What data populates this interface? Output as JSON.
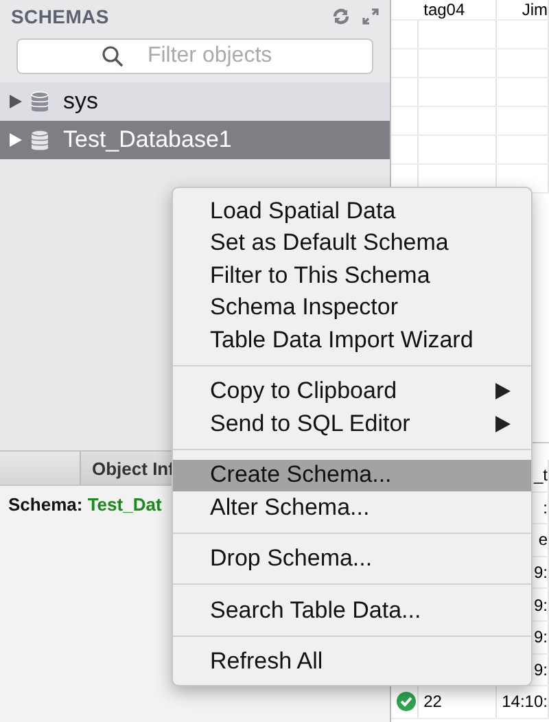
{
  "schemas_panel": {
    "title": "SCHEMAS",
    "search": {
      "placeholder": "Filter objects"
    },
    "items": [
      {
        "label": "sys",
        "selected": false,
        "expanded": false
      },
      {
        "label": "Test_Database1",
        "selected": true,
        "expanded": false
      }
    ]
  },
  "info_panel": {
    "tabs": [
      {
        "selected": false
      },
      {
        "label": "Object Inf",
        "selected": true
      }
    ],
    "schema_label": "Schema:",
    "schema_name": "Test_Dat"
  },
  "result_grid_top": {
    "rows": [
      [
        "",
        "tag04",
        "Jim"
      ],
      [
        "",
        "",
        ""
      ],
      [
        "",
        "",
        ""
      ],
      [
        "",
        "",
        ""
      ],
      [
        "",
        "",
        ""
      ],
      [
        "",
        "",
        ""
      ],
      [
        "",
        "",
        ""
      ]
    ]
  },
  "result_grid_bottom": {
    "rows": [
      {
        "cells": [
          "",
          "",
          "_t"
        ]
      },
      {
        "cells": [
          "",
          "",
          ":"
        ]
      },
      {
        "cells": [
          "",
          "",
          "e"
        ]
      },
      {
        "cells": [
          "",
          "",
          "9:"
        ]
      },
      {
        "cells": [
          "",
          "",
          "9:"
        ]
      },
      {
        "cells": [
          "",
          "",
          "9:"
        ]
      },
      {
        "cells": [
          "",
          "",
          "9:"
        ]
      },
      {
        "ok": true,
        "cells": [
          "",
          "22",
          "14:10:"
        ]
      }
    ]
  },
  "context_menu": {
    "items": [
      {
        "kind": "item",
        "label": "Load Spatial Data",
        "selected": false,
        "submenu": false
      },
      {
        "kind": "item",
        "label": "Set as Default Schema",
        "selected": false,
        "submenu": false
      },
      {
        "kind": "item",
        "label": "Filter to This Schema",
        "selected": false,
        "submenu": false
      },
      {
        "kind": "item",
        "label": "Schema Inspector",
        "selected": false,
        "submenu": false
      },
      {
        "kind": "item",
        "label": "Table Data Import Wizard",
        "selected": false,
        "submenu": false
      },
      {
        "kind": "separator"
      },
      {
        "kind": "item",
        "label": "Copy to Clipboard",
        "selected": false,
        "submenu": true
      },
      {
        "kind": "item",
        "label": "Send to SQL Editor",
        "selected": false,
        "submenu": true
      },
      {
        "kind": "separator"
      },
      {
        "kind": "item",
        "label": "Create Schema...",
        "selected": true,
        "submenu": false
      },
      {
        "kind": "item",
        "label": "Alter Schema...",
        "selected": false,
        "submenu": false
      },
      {
        "kind": "separator"
      },
      {
        "kind": "item",
        "label": "Drop Schema...",
        "selected": false,
        "submenu": false
      },
      {
        "kind": "separator"
      },
      {
        "kind": "item",
        "label": "Search Table Data...",
        "selected": false,
        "submenu": false
      },
      {
        "kind": "separator"
      },
      {
        "kind": "item",
        "label": "Refresh All",
        "selected": false,
        "submenu": false
      }
    ]
  }
}
